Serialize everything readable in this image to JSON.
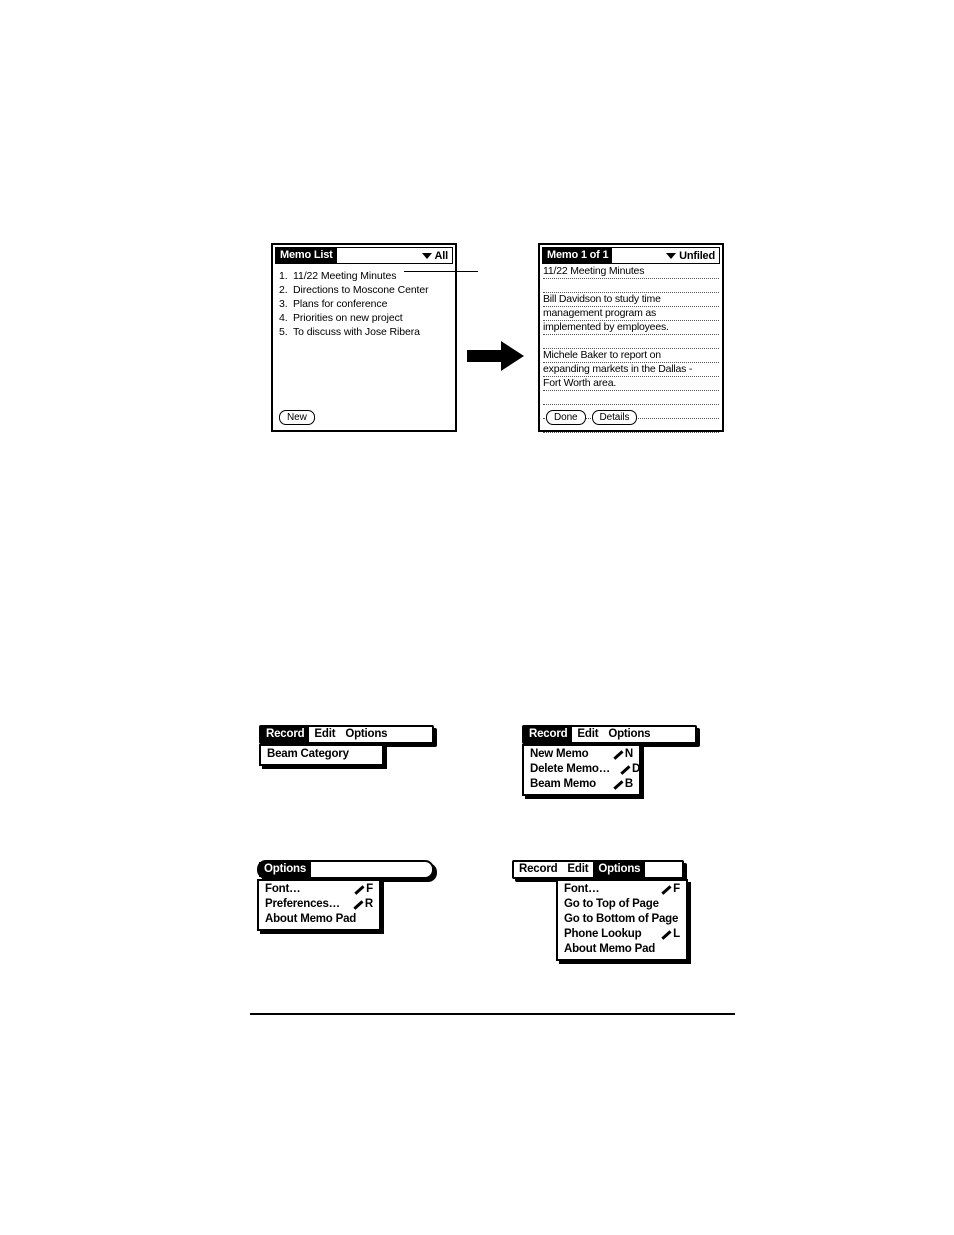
{
  "memo_list_screen": {
    "title": "Memo List",
    "category": "All",
    "category_icon": "chevron-down-icon",
    "items": [
      {
        "num": "1.",
        "text": "11/22 Meeting Minutes"
      },
      {
        "num": "2.",
        "text": "Directions to Moscone Center"
      },
      {
        "num": "3.",
        "text": "Plans for conference"
      },
      {
        "num": "4.",
        "text": "Priorities on new project"
      },
      {
        "num": "5.",
        "text": "To discuss with Jose Ribera"
      }
    ],
    "buttons": [
      {
        "label": "New"
      }
    ]
  },
  "memo_detail_screen": {
    "title": "Memo 1 of 1",
    "category": "Unfiled",
    "category_icon": "chevron-down-icon",
    "lines": [
      "11/22 Meeting Minutes",
      "",
      "Bill Davidson to study time",
      "management program as",
      "implemented by employees.",
      "",
      "Michele Baker to report on",
      "expanding markets in the Dallas -",
      "Fort Worth area.",
      "",
      "",
      ""
    ],
    "buttons": [
      {
        "label": "Done"
      },
      {
        "label": "Details"
      }
    ]
  },
  "flow_arrow": {
    "icon": "right-arrow-icon",
    "color": "#000000"
  },
  "menus": {
    "record_category_menu": {
      "menubar": [
        {
          "label": "Record",
          "selected": true
        },
        {
          "label": "Edit",
          "selected": false
        },
        {
          "label": "Options",
          "selected": false
        }
      ],
      "items": [
        {
          "label": "Beam Category",
          "shortcut": ""
        }
      ]
    },
    "record_memo_menu": {
      "menubar": [
        {
          "label": "Record",
          "selected": true
        },
        {
          "label": "Edit",
          "selected": false
        },
        {
          "label": "Options",
          "selected": false
        }
      ],
      "items": [
        {
          "label": "New Memo",
          "shortcut": "N"
        },
        {
          "label": "Delete Memo…",
          "shortcut": "D"
        },
        {
          "label": "Beam Memo",
          "shortcut": "B"
        }
      ]
    },
    "options_list_menu": {
      "menubar": [
        {
          "label": "Options",
          "selected": true
        }
      ],
      "items": [
        {
          "label": "Font…",
          "shortcut": "F"
        },
        {
          "label": "Preferences…",
          "shortcut": "R"
        },
        {
          "label": "About Memo Pad",
          "shortcut": ""
        }
      ]
    },
    "options_detail_menu": {
      "menubar": [
        {
          "label": "Record",
          "selected": false
        },
        {
          "label": "Edit",
          "selected": false
        },
        {
          "label": "Options",
          "selected": true
        }
      ],
      "items": [
        {
          "label": "Font…",
          "shortcut": "F"
        },
        {
          "label": "Go to Top of Page",
          "shortcut": ""
        },
        {
          "label": "Go to Bottom of Page",
          "shortcut": ""
        },
        {
          "label": "Phone Lookup",
          "shortcut": "L"
        },
        {
          "label": "About Memo Pad",
          "shortcut": ""
        }
      ]
    }
  }
}
